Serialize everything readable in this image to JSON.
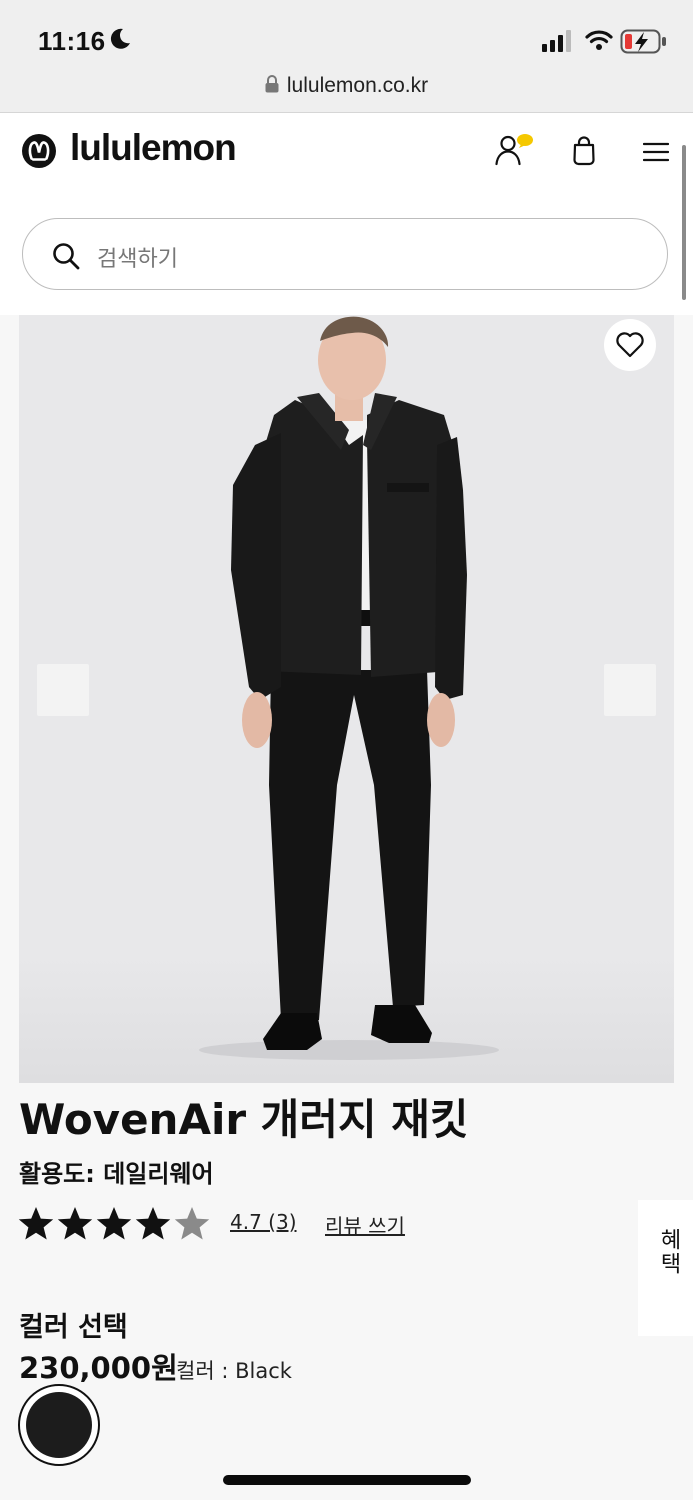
{
  "status_bar": {
    "time": "11:16"
  },
  "browser": {
    "url": "lululemon.co.kr"
  },
  "header": {
    "brand": "lululemon"
  },
  "search": {
    "placeholder": "검색하기"
  },
  "product": {
    "title": "WovenAir 개러지 재킷",
    "activity_label": "활용도:",
    "activity_value": "데일리웨어",
    "rating_display": "4.7 (3)",
    "rating_value": 4.7,
    "review_count": 3,
    "write_review": "리뷰 쓰기",
    "color_section_label": "컬러 선택",
    "price": "230,000원",
    "color_prefix": "컬러 : ",
    "color_name": "Black",
    "swatch_color": "#1c1c1c"
  },
  "side_tab": {
    "label": "혜택"
  }
}
